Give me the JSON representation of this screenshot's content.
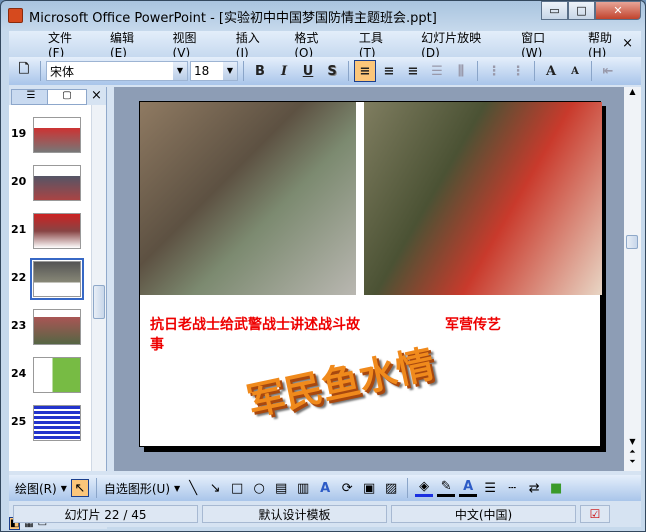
{
  "window": {
    "title": "Microsoft Office PowerPoint - [实验初中中国梦国防情主题班会.ppt]",
    "minimize": "▭",
    "maximize": "□",
    "close": "✕"
  },
  "menu": [
    "文件(F)",
    "编辑(E)",
    "视图(V)",
    "插入(I)",
    "格式(O)",
    "工具(T)",
    "幻灯片放映(D)",
    "窗口(W)",
    "帮助(H)"
  ],
  "menu_close": "×",
  "toolbar": {
    "font": "宋体",
    "size": "18",
    "bold": "B",
    "italic": "I",
    "underline": "U",
    "shadow": "S",
    "grow": "A",
    "shrink": "A"
  },
  "pane": {
    "tab_close": "×",
    "thumbnails": [
      {
        "num": "19"
      },
      {
        "num": "20"
      },
      {
        "num": "21"
      },
      {
        "num": "22",
        "current": true
      },
      {
        "num": "23"
      },
      {
        "num": "24"
      },
      {
        "num": "25"
      }
    ]
  },
  "slide": {
    "caption_left": "抗日老战士给武警战士讲述战斗故事",
    "caption_right": "军营传艺",
    "wordart": "军民鱼水情"
  },
  "drawing": {
    "draw_label": "绘图(R)",
    "autoshape_label": "自选图形(U)",
    "accent_fill": "#1a2fe0"
  },
  "status": {
    "slide": "幻灯片 22 / 45",
    "template": "默认设计模板",
    "language": "中文(中国)"
  }
}
